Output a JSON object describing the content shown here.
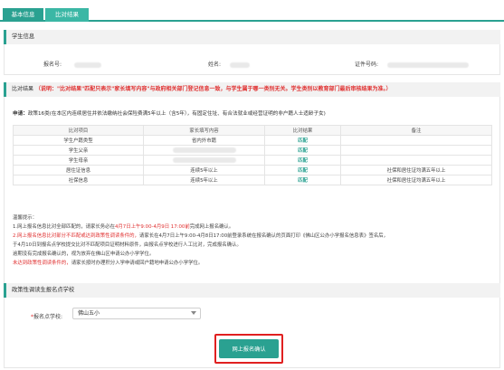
{
  "tabs": [
    "基本信息",
    "比对结果"
  ],
  "student_section": {
    "title": "学生信息",
    "reg_label": "报名号:",
    "name_label": "姓名:",
    "id_label": "证件号码:"
  },
  "compare_section": {
    "title_prefix": "比对结果",
    "title_red": "（说明：\"比对结果\"匹配只表示\"家长填写内容\"与政府相关部门登记信息一致，与学生属于哪一类别无关。学生类别以教育部门最后审核结果为准。）",
    "apply_label": "申请：",
    "apply_text": "政策16类(在本区内连续居住并依法缴纳社会保险费满5年以上（含5年），有固定住址、有合法就业或经营证明的非户籍人士适龄子女)",
    "table_headers": [
      "比对项目",
      "家长填写内容",
      "比对结果",
      "备注"
    ],
    "rows": [
      {
        "item": "学生户籍类型",
        "content": "省内外市籍",
        "result": "匹配",
        "note": ""
      },
      {
        "item": "学生父亲",
        "content": "",
        "result": "匹配",
        "note": ""
      },
      {
        "item": "学生母亲",
        "content": "",
        "result": "匹配",
        "note": ""
      },
      {
        "item": "居住证信息",
        "content": "连续5年以上",
        "result": "匹配",
        "note": "社保和居住证均满五年以上"
      },
      {
        "item": "社保信息",
        "content": "连续5年以上",
        "result": "匹配",
        "note": "社保和居住证均满五年以上"
      }
    ]
  },
  "tips": {
    "title": "温馨提示：",
    "line1_a": "1.网上报名信息比对全部匹配的，请家长务必在",
    "line1_red": "4月7日上午9:00-4月9日 17:00前",
    "line1_b": "完成网上报名确认。",
    "line2_red": "2.网上报名信息比对部分不匹配或达到政策性调读条件的，",
    "line2_b": "请家长在4月7日上午9:00-4月8日17:00前登录系统在报名确认的页面打印《佛山区公办小学报名信息表》签名后，",
    "line3": "于4月10日到报名点学校提交比对不匹配项目证明材料原件，由报名点学校进行人工比对，完成报名确认。",
    "line4": "逾期没有完成报名确认的，视为放弃在佛山区申请公办小学学位。",
    "line5_red": "未达到政策性调读条件的，",
    "line5_b": "请家长按时办理积分入学申请或回户籍地申请公办小学学位。"
  },
  "school_section": {
    "title": "政策性调读生报名点学校",
    "label_star": "*",
    "label": "报名点学校:",
    "selected": "佛山五小"
  },
  "confirm_button": "网上报名确认"
}
